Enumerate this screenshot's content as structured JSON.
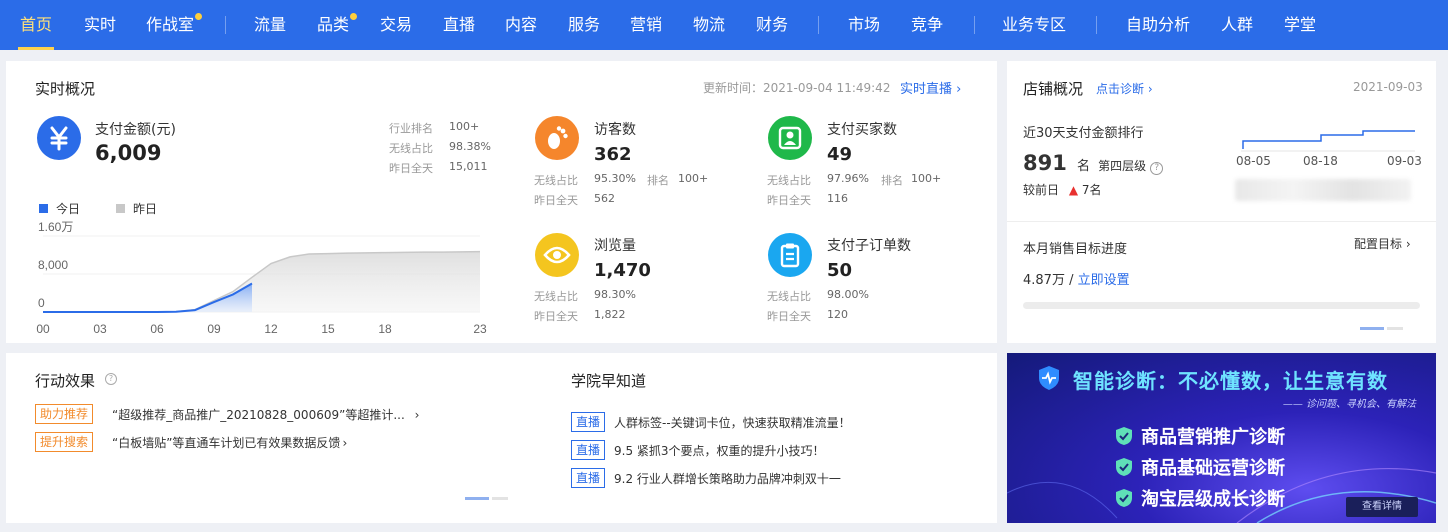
{
  "nav": {
    "items": [
      {
        "label": "首页",
        "active": true,
        "dot": false
      },
      {
        "label": "实时",
        "active": false,
        "dot": false
      },
      {
        "label": "作战室",
        "active": false,
        "dot": true
      },
      {
        "label": "流量",
        "active": false,
        "dot": false
      },
      {
        "label": "品类",
        "active": false,
        "dot": true
      },
      {
        "label": "交易",
        "active": false,
        "dot": false
      },
      {
        "label": "直播",
        "active": false,
        "dot": false
      },
      {
        "label": "内容",
        "active": false,
        "dot": false
      },
      {
        "label": "服务",
        "active": false,
        "dot": false
      },
      {
        "label": "营销",
        "active": false,
        "dot": false
      },
      {
        "label": "物流",
        "active": false,
        "dot": false
      },
      {
        "label": "财务",
        "active": false,
        "dot": false
      },
      {
        "label": "市场",
        "active": false,
        "dot": false
      },
      {
        "label": "竞争",
        "active": false,
        "dot": false
      },
      {
        "label": "业务专区",
        "active": false,
        "dot": false
      },
      {
        "label": "自助分析",
        "active": false,
        "dot": false
      },
      {
        "label": "人群",
        "active": false,
        "dot": false
      },
      {
        "label": "学堂",
        "active": false,
        "dot": false
      }
    ]
  },
  "realtime": {
    "title": "实时概况",
    "update_label": "更新时间：2021-09-04 11:49:42",
    "live_link": "实时直播",
    "pay": {
      "icon": "yen-icon",
      "label": "支付金额(元)",
      "value": "6,009",
      "rank_label": "行业排名",
      "rank_value": "100+",
      "wireless_label": "无线占比",
      "wireless_value": "98.38%",
      "yesterday_label": "昨日全天",
      "yesterday_value": "15,011"
    },
    "legend": {
      "today": "今日",
      "yesterday": "昨日"
    },
    "metrics": [
      {
        "icon": "footprint-icon",
        "color": "#f5862c",
        "label": "访客数",
        "value": "362",
        "wireless_label": "无线占比",
        "wireless_value": "95.30%",
        "rank_label": "排名",
        "rank_value": "100+",
        "yesterday_label": "昨日全天",
        "yesterday_value": "562"
      },
      {
        "icon": "buyers-icon",
        "color": "#1fb84a",
        "label": "支付买家数",
        "value": "49",
        "wireless_label": "无线占比",
        "wireless_value": "97.96%",
        "rank_label": "排名",
        "rank_value": "100+",
        "yesterday_label": "昨日全天",
        "yesterday_value": "116"
      },
      {
        "icon": "eye-icon",
        "color": "#f4c51f",
        "label": "浏览量",
        "value": "1,470",
        "wireless_label": "无线占比",
        "wireless_value": "98.30%",
        "rank_label": "",
        "rank_value": "",
        "yesterday_label": "昨日全天",
        "yesterday_value": "1,822"
      },
      {
        "icon": "clipboard-icon",
        "color": "#1aa7f0",
        "label": "支付子订单数",
        "value": "50",
        "wireless_label": "无线占比",
        "wireless_value": "98.00%",
        "rank_label": "",
        "rank_value": "",
        "yesterday_label": "昨日全天",
        "yesterday_value": "120"
      }
    ]
  },
  "chart_data": {
    "type": "area",
    "x": [
      0,
      1,
      2,
      3,
      4,
      5,
      6,
      7,
      8,
      9,
      10,
      11,
      12,
      13,
      14,
      15,
      16,
      17,
      18,
      19,
      20,
      21,
      22,
      23
    ],
    "xticks": [
      "00",
      "03",
      "06",
      "09",
      "12",
      "15",
      "18",
      "23"
    ],
    "xtick_values": [
      0,
      3,
      6,
      9,
      12,
      15,
      18,
      23
    ],
    "yticks": [
      "0",
      "8,000",
      "1.60万"
    ],
    "ytick_values": [
      0,
      8000,
      16000
    ],
    "ylim": [
      0,
      16000
    ],
    "series": [
      {
        "name": "今日",
        "color": "#2b6ce8",
        "values": [
          0,
          0,
          0,
          0,
          0,
          0,
          0,
          50,
          400,
          2100,
          3700,
          6009
        ]
      },
      {
        "name": "昨日",
        "color": "#c8c8c8",
        "values": [
          0,
          0,
          0,
          0,
          0,
          0,
          0,
          50,
          500,
          2400,
          4300,
          7300,
          10200,
          11600,
          12200,
          12300,
          12400,
          12450,
          12500,
          12550,
          12600,
          12600,
          12650,
          12700
        ]
      }
    ]
  },
  "shop": {
    "title": "店铺概况",
    "diagnose_link": "点击诊断",
    "date": "2021-09-03",
    "rank_title": "近30天支付金额排行",
    "rank_value": "891",
    "rank_unit": "名",
    "tier": "第四层级",
    "compare_label": "较前日",
    "compare_value": "7名",
    "mini_dates": [
      "08-05",
      "08-18",
      "09-03"
    ],
    "target_title": "本月销售目标进度",
    "target_config": "配置目标",
    "target_value": "4.87万",
    "target_sep": "/",
    "target_link": "立即设置"
  },
  "actions": {
    "title": "行动效果",
    "items": [
      {
        "tag": "助力推荐",
        "text": "“超级推荐_商品推广_20210828_000609”等超推计..."
      },
      {
        "tag": "提升搜索",
        "text": "“白板墙贴”等直通车计划已有效果数据反馈"
      }
    ]
  },
  "academy": {
    "title": "学院早知道",
    "items": [
      {
        "tag": "直播",
        "text": "人群标签--关键词卡位，快速获取精准流量！"
      },
      {
        "tag": "直播",
        "text": "9.5 紧抓3个要点，权重的提升小技巧！"
      },
      {
        "tag": "直播",
        "text": "9.2 行业人群增长策略助力品牌冲刺双十一"
      }
    ]
  },
  "banner": {
    "title": "智能诊断：不必懂数，让生意有数",
    "subtitle": "—— 诊问题、寻机会、有解法",
    "items": [
      "商品营销推广诊断",
      "商品基础运营诊断",
      "淘宝层级成长诊断"
    ],
    "button": "查看详情"
  }
}
